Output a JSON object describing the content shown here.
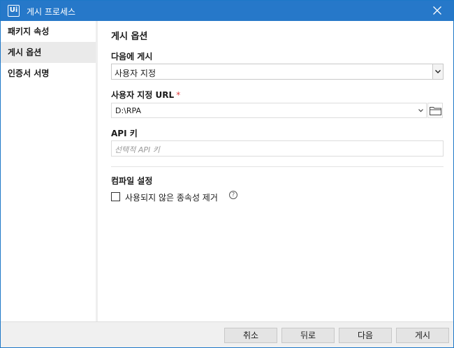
{
  "window": {
    "title": "게시 프로세스",
    "app_icon_text": "Ui",
    "accent_color": "#2678c9"
  },
  "sidebar": {
    "items": [
      {
        "label": "패키지 속성",
        "active": false
      },
      {
        "label": "게시 옵션",
        "active": true
      },
      {
        "label": "인증서 서명",
        "active": false
      }
    ]
  },
  "main": {
    "heading": "게시 옵션",
    "publish_to": {
      "label": "다음에 게시",
      "selected": "사용자 지정"
    },
    "custom_url": {
      "label": "사용자 지정 URL",
      "required_mark": "*",
      "value": "D:\\RPA"
    },
    "api_key": {
      "label": "API 키",
      "placeholder": "선택적 API 키"
    },
    "compile": {
      "label": "컴파일 설정",
      "checkbox_label": "사용되지 않은 종속성 제거",
      "checked": false,
      "help_icon_text": "?"
    }
  },
  "footer": {
    "cancel": "취소",
    "back": "뒤로",
    "next": "다음",
    "publish": "게시"
  }
}
